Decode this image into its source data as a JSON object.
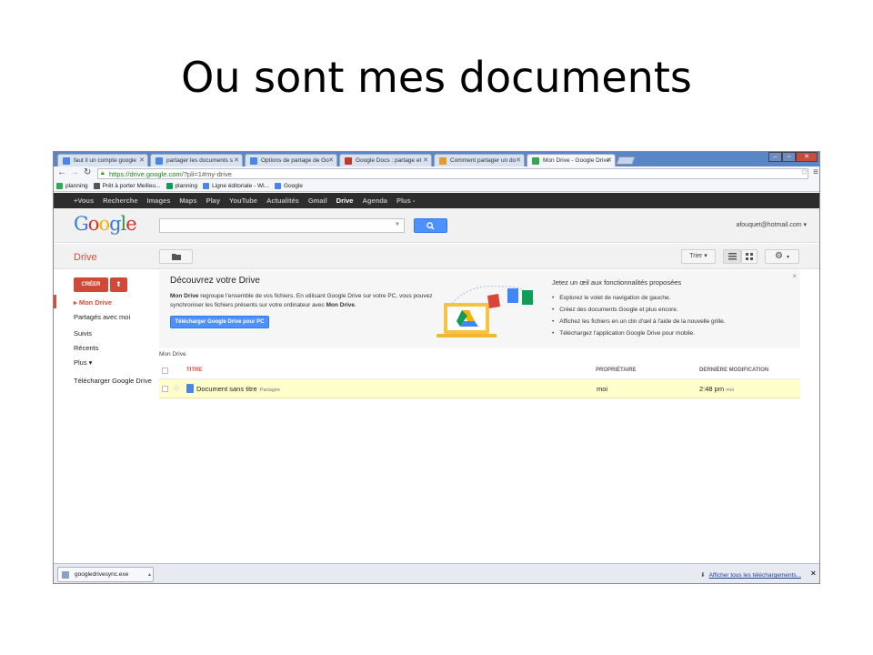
{
  "slide": {
    "title": "Ou sont mes documents"
  },
  "browser": {
    "tabs": [
      {
        "label": "faut il un compte google",
        "active": false,
        "favicon_color": "#4a86e8"
      },
      {
        "label": "partager les documents s",
        "active": false,
        "favicon_color": "#4a86e8"
      },
      {
        "label": "Options de partage de Go",
        "active": false,
        "favicon_color": "#4a86e8"
      },
      {
        "label": "Google Docs : partage et",
        "active": false,
        "favicon_color": "#c0392b"
      },
      {
        "label": "Comment partager un do",
        "active": false,
        "favicon_color": "#e39a2f"
      },
      {
        "label": "Mon Drive - Google Drive",
        "active": true,
        "favicon_color": "#34a853"
      }
    ],
    "url_https": "https://drive.google.com",
    "url_rest": "/?pli=1#my-drive",
    "bookmarks": [
      {
        "label": "planning",
        "icon_color": "#34a853"
      },
      {
        "label": "Prêt à porter Meilleu...",
        "icon_color": "#555555"
      },
      {
        "label": "planning",
        "icon_color": "#0f9d58"
      },
      {
        "label": "Ligne éditoriale - Wi...",
        "icon_color": "#4a86e8"
      },
      {
        "label": "Google",
        "icon_color": "#4a86e8"
      }
    ]
  },
  "google_bar": {
    "items": [
      "+Vous",
      "Recherche",
      "Images",
      "Maps",
      "Play",
      "YouTube",
      "Actualités",
      "Gmail",
      "Drive",
      "Agenda",
      "Plus -"
    ],
    "selected": "Drive"
  },
  "header": {
    "logo_letters": [
      {
        "ch": "G",
        "color": "#3b78e7"
      },
      {
        "ch": "o",
        "color": "#d9301f"
      },
      {
        "ch": "o",
        "color": "#f2b400"
      },
      {
        "ch": "g",
        "color": "#3b78e7"
      },
      {
        "ch": "l",
        "color": "#2d9c4a"
      },
      {
        "ch": "e",
        "color": "#d9301f"
      }
    ],
    "search_button_icon": "search-icon",
    "account": "afouquet@hotmail.com ▾"
  },
  "toolbar": {
    "title": "Drive",
    "sort_label": "Trier ▾",
    "settings_icon": "gear-icon"
  },
  "sidebar": {
    "create_label": "CRÉER",
    "items": [
      {
        "label": "▸ Mon Drive",
        "active": true
      },
      {
        "label": "Partagés avec moi",
        "active": false
      },
      {
        "label": "Suivis",
        "active": false
      },
      {
        "label": "Récents",
        "active": false
      },
      {
        "label": "Plus ▾",
        "active": false
      },
      {
        "label": "Télécharger Google Drive",
        "active": false
      }
    ]
  },
  "promo": {
    "title": "Découvrez votre Drive",
    "text_bold1": "Mon Drive",
    "text_mid": " regroupe l'ensemble de vos fichiers. En utilisant Google Drive sur votre PC, vous pouvez synchroniser les fichiers présents sur votre ordinateur avec ",
    "text_bold2": "Mon Drive",
    "text_end": ".",
    "button": "Télécharger Google Drive pour PC",
    "right_title": "Jetez un œil aux fonctionnalités proposées",
    "right_items": [
      "Explorez le volet de navigation de gauche.",
      "Créez des documents Google et plus encore.",
      "Affichez les fichiers en un clin d'œil à l'aide de la nouvelle grille.",
      "Téléchargez l'application Google Drive pour mobile."
    ],
    "close": "×"
  },
  "file_list": {
    "breadcrumb": "Mon Drive",
    "columns": {
      "title": "TITRE",
      "owner": "PROPRIÉTAIRE",
      "modified": "DERNIÈRE MODIFICATION"
    },
    "rows": [
      {
        "title": "Document sans titre",
        "tag": "Partagée",
        "owner": "moi",
        "time": "2:48 pm",
        "by": "moi"
      }
    ]
  },
  "downloads": {
    "file": "googledrivesync.exe",
    "show_all": "Afficher tous les téléchargements...",
    "close": "×"
  }
}
